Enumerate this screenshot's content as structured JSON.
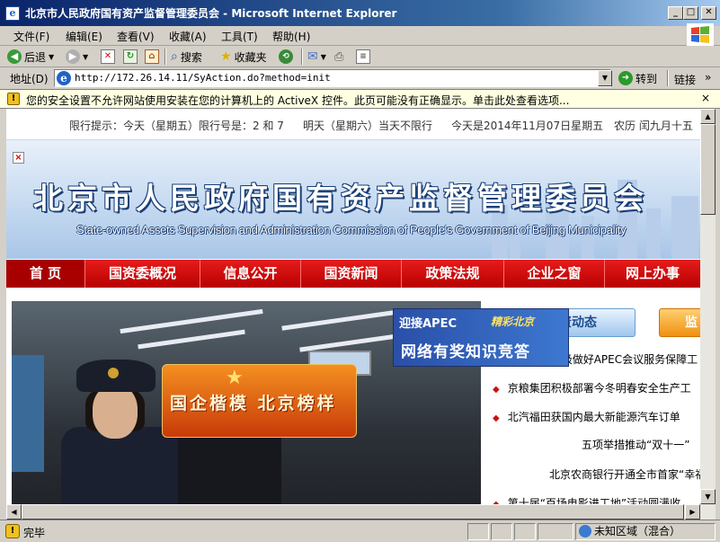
{
  "window": {
    "title": "北京市人民政府国有资产监督管理委员会 - Microsoft Internet Explorer",
    "buttons": {
      "minimize": "_",
      "maximize": "□",
      "close": "✕"
    }
  },
  "menu": [
    "文件(F)",
    "编辑(E)",
    "查看(V)",
    "收藏(A)",
    "工具(T)",
    "帮助(H)"
  ],
  "toolbar": {
    "back": "后退",
    "search": "搜索",
    "favorites": "收藏夹"
  },
  "address": {
    "label": "地址(D)",
    "url": "http://172.26.14.11/SyAction.do?method=init",
    "go": "转到",
    "links": "链接"
  },
  "infobar": {
    "text": "您的安全设置不允许网站使用安装在您的计算机上的 ActiveX 控件。此页可能没有正确显示。单击此处查看选项...",
    "close": "×"
  },
  "page": {
    "strip": {
      "limit_today": "限行提示：今天（星期五）限行号是：2 和 7",
      "limit_tomorrow": "明天（星期六）当天不限行",
      "date": "今天是2014年11月07日星期五",
      "lunar": "农历  闰九月十五"
    },
    "banner": {
      "title_cn": "北京市人民政府国有资产监督管理委员会",
      "title_en": "State-owned Assets Supervision and Administration Commission of People's Government of Beijing Municipality",
      "close": "×"
    },
    "nav": [
      "首  页",
      "国资委概况",
      "信息公开",
      "国资新闻",
      "政策法规",
      "企业之窗",
      "网上办事"
    ],
    "promo1": "国企楷模 北京榜样",
    "promo2": {
      "top": "迎接APEC",
      "sub": "精彩北京",
      "main": "网络有奖知识竞答"
    },
    "sections": {
      "dynamics": "北京国资动态",
      "second": "监"
    },
    "news": [
      "相关企业积极做好APEC会议服务保障工",
      "京粮集团积极部署今冬明春安全生产工",
      "北汽福田获国内最大新能源汽车订单",
      "五项举措推动“双十一”",
      "北京农商银行开通全市首家“幸福彩线",
      "第十届“百场电影进工地”活动圆满收"
    ]
  },
  "status": {
    "text": "完毕",
    "zone": "未知区域（混合）"
  }
}
